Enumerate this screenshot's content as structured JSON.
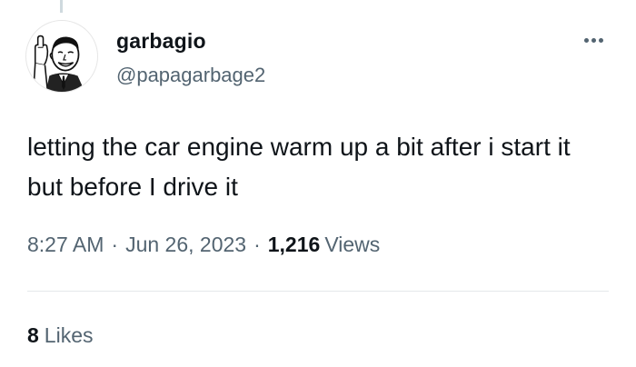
{
  "tweet": {
    "author": {
      "display_name": "garbagio",
      "handle": "@papagarbage2",
      "avatar_icon": "retro-man-middle-finger-avatar"
    },
    "more_icon": "more-horizontal-icon",
    "text": "letting the car engine warm up a bit after i start it but before I drive it",
    "time": "8:27 AM",
    "date": "Jun 26, 2023",
    "separator": "·",
    "views_count": "1,216",
    "views_label": "Views",
    "likes_count": "8",
    "likes_label": "Likes"
  },
  "colors": {
    "text_primary": "#0f1419",
    "text_secondary": "#536471",
    "divider": "#e4e8eb",
    "background": "#ffffff"
  }
}
